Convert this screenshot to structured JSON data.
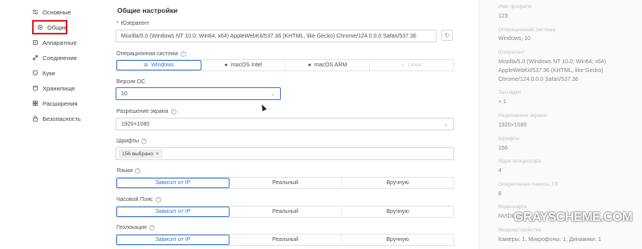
{
  "sidebar": {
    "items": [
      {
        "label": "Основные",
        "icon": "sliders-icon"
      },
      {
        "label": "Общие",
        "icon": "gear-icon",
        "active": true
      },
      {
        "label": "Аппаратные",
        "icon": "chip-icon"
      },
      {
        "label": "Соединение",
        "icon": "link-icon"
      },
      {
        "label": "Куки",
        "icon": "cookie-icon"
      },
      {
        "label": "Хранилище",
        "icon": "database-icon"
      },
      {
        "label": "Расширения",
        "icon": "grid-icon"
      },
      {
        "label": "Безопасность",
        "icon": "lock-icon"
      }
    ],
    "highlight_color": "#e01b24"
  },
  "main": {
    "title": "Общие настройки",
    "user_agent": {
      "label": "Юзерагент",
      "value": "Mozilla/5.0 (Windows NT 10.0; Win64; x64) AppleWebKit/537.36 (KHTML, like Gecko) Chrome/124.0.0.0 Safari/537.36"
    },
    "os": {
      "label": "Операционная система",
      "options": [
        "Windows",
        "macOS Intel",
        "macOS ARM",
        "Linux"
      ],
      "selected": "Windows"
    },
    "os_version": {
      "label": "Версия ОС",
      "value": "10"
    },
    "screen_resolution": {
      "label": "Разрешение экрана",
      "value": "1920×1080"
    },
    "fonts": {
      "label": "Шрифты",
      "chip": "156 выбрано",
      "chip_close": "×"
    },
    "languages": {
      "label": "Языки",
      "options": [
        "Зависит от IP",
        "Реальный",
        "Вручную"
      ],
      "selected": "Зависит от IP"
    },
    "timezone": {
      "label": "Часовой Пояс",
      "options": [
        "Зависит от IP",
        "Реальный",
        "Вручную"
      ],
      "selected": "Зависит от IP"
    },
    "geolocation": {
      "label": "Геолокация",
      "options": [
        "Зависит от IP",
        "Реальный",
        "Вручную"
      ],
      "selected": "Зависит от IP"
    },
    "accent_color": "#3a78d6"
  },
  "summary": {
    "profile_name_label": "Имя профиля",
    "profile_name_value": "123",
    "os_label": "Операционная система",
    "os_value": "Windows, 10",
    "ua_label": "Юзерагент",
    "ua_line1": "Mozilla/5.0 (Windows NT 10.0; Win64; x64)",
    "ua_line2": "AppleWebKit/537.36 (KHTML, like Gecko)",
    "ua_line3": "Chrome/124.0.0.0 Safari/537.36",
    "bookmarks_label": "Закладки",
    "bookmarks_value": "+ 1",
    "resolution_label": "Разрешение экрана",
    "resolution_value": "1920×1080",
    "fonts_label": "Шрифты",
    "fonts_value": "156",
    "cores_label": "Ядра процессора",
    "cores_value": "4",
    "ram_label": "Оперативная память, Гб",
    "ram_value": "8",
    "gpu_label": "Видеокарта",
    "gpu_value": "NVIDIA",
    "media_label": "Медиаустройства",
    "media_value": "Камеры: 1, Микрофоны: 1, Динамики: 1"
  },
  "watermark": "GRAYSCHEME.COM"
}
